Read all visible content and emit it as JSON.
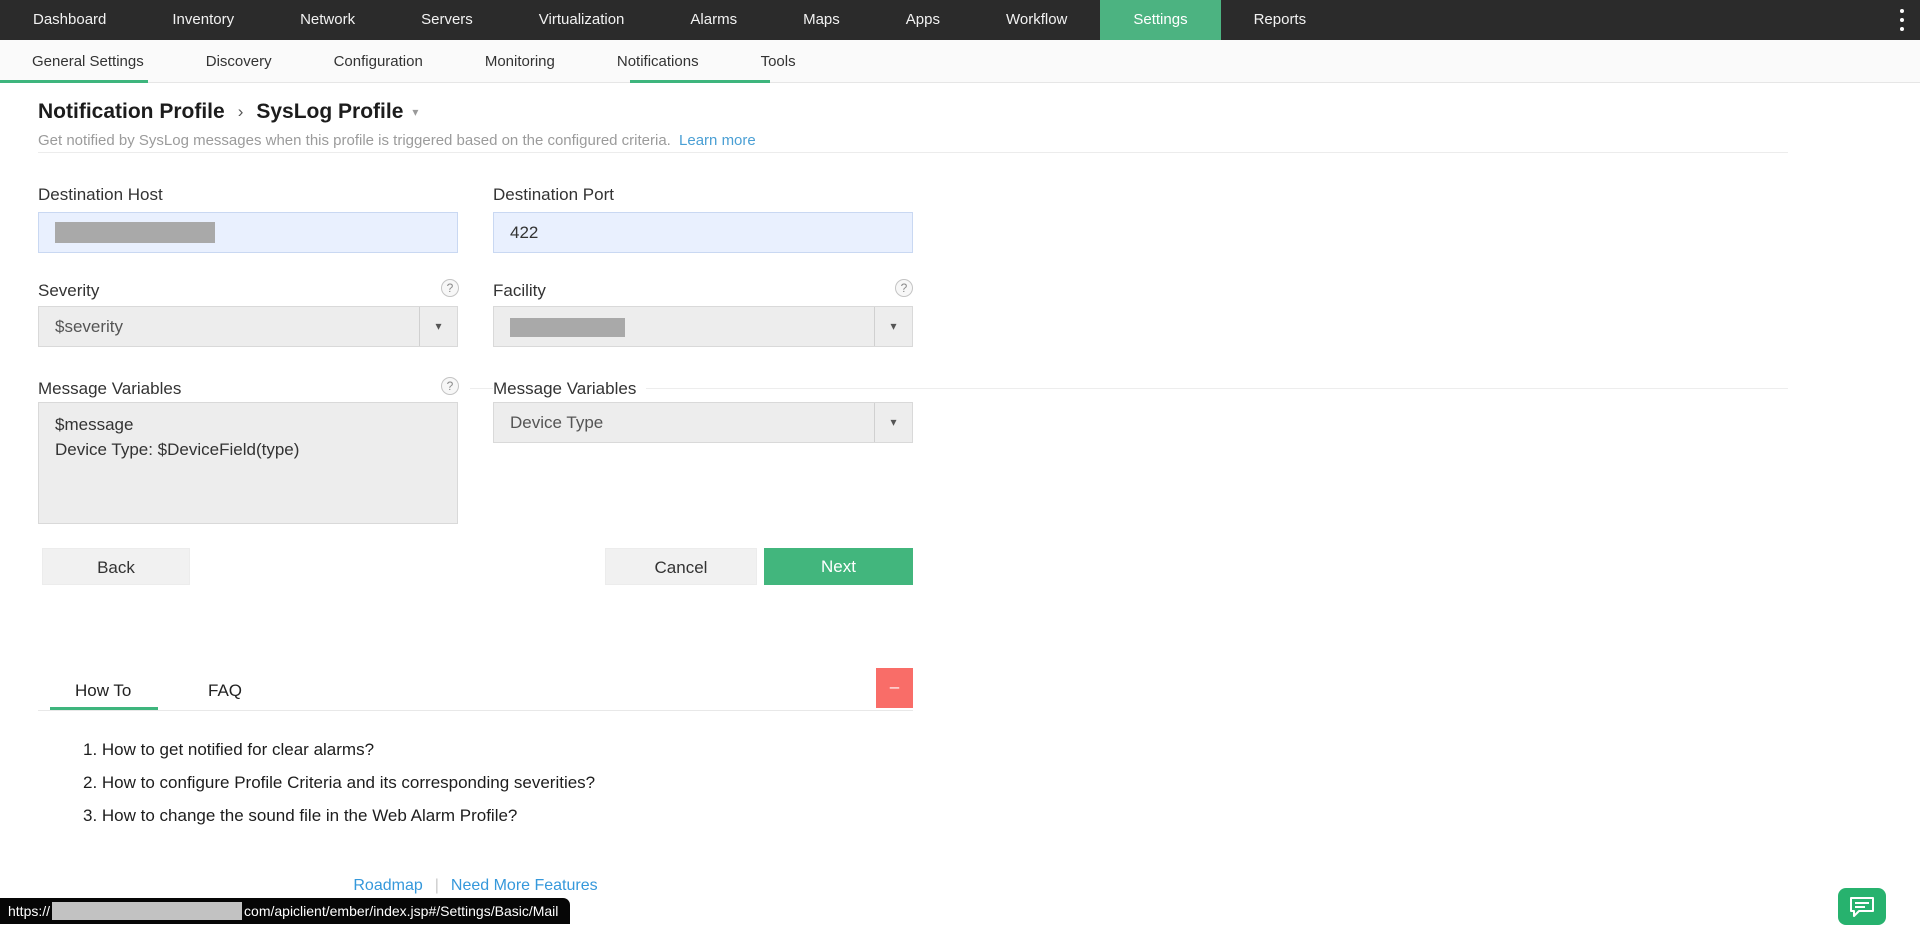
{
  "top_nav": {
    "items": [
      {
        "label": "Dashboard",
        "active": false
      },
      {
        "label": "Inventory",
        "active": false
      },
      {
        "label": "Network",
        "active": false
      },
      {
        "label": "Servers",
        "active": false
      },
      {
        "label": "Virtualization",
        "active": false
      },
      {
        "label": "Alarms",
        "active": false
      },
      {
        "label": "Maps",
        "active": false
      },
      {
        "label": "Apps",
        "active": false
      },
      {
        "label": "Workflow",
        "active": false
      },
      {
        "label": "Settings",
        "active": true
      },
      {
        "label": "Reports",
        "active": false
      }
    ]
  },
  "sub_nav": {
    "items": [
      {
        "label": "General Settings"
      },
      {
        "label": "Discovery"
      },
      {
        "label": "Configuration"
      },
      {
        "label": "Monitoring"
      },
      {
        "label": "Notifications"
      },
      {
        "label": "Tools"
      }
    ]
  },
  "breadcrumb": {
    "parent": "Notification Profile",
    "separator": "›",
    "current": "SysLog Profile",
    "caret": "▾"
  },
  "intro": {
    "text": "Get notified by SysLog messages when this profile is triggered based on the configured criteria.",
    "link": "Learn more"
  },
  "form": {
    "destination_host": {
      "label": "Destination Host",
      "value": "",
      "redacted": true
    },
    "destination_port": {
      "label": "Destination Port",
      "value": "422"
    },
    "severity": {
      "label": "Severity",
      "value": "$severity",
      "help": "?",
      "caret": "▾"
    },
    "facility": {
      "label": "Facility",
      "value": "",
      "redacted": true,
      "help": "?",
      "caret": "▾"
    },
    "message_variables_text": {
      "label": "Message Variables",
      "help": "?",
      "value": "$message\nDevice Type: $DeviceField(type)"
    },
    "message_variables_select": {
      "label": "Message Variables",
      "value": "Device Type",
      "caret": "▾"
    },
    "buttons": {
      "back": "Back",
      "cancel": "Cancel",
      "next": "Next"
    }
  },
  "help_card": {
    "tabs": [
      {
        "label": "How To",
        "active": true
      },
      {
        "label": "FAQ",
        "active": false
      }
    ],
    "minimize": "–",
    "items": [
      "1. How to get notified for clear alarms?",
      "2. How to configure Profile Criteria and its corresponding severities?",
      "3. How to change the sound file in the Web Alarm Profile?"
    ],
    "footer": {
      "roadmap": "Roadmap",
      "separator": "|",
      "need_more": "Need More Features"
    }
  },
  "status_bar": {
    "url_prefix": "https://",
    "url_suffix": "com/apiclient/ember/index.jsp#/Settings/Basic/Mail"
  },
  "colors": {
    "topnav_bg": "#2b2b2b",
    "accent_green": "#3eb57d",
    "active_nav_green": "#4cb381",
    "next_button_green": "#42b67d",
    "minimize_red": "#f96d68",
    "chat_green": "#27b26e",
    "autofill_blue": "#e9f0fe",
    "link_blue": "#3598db"
  }
}
